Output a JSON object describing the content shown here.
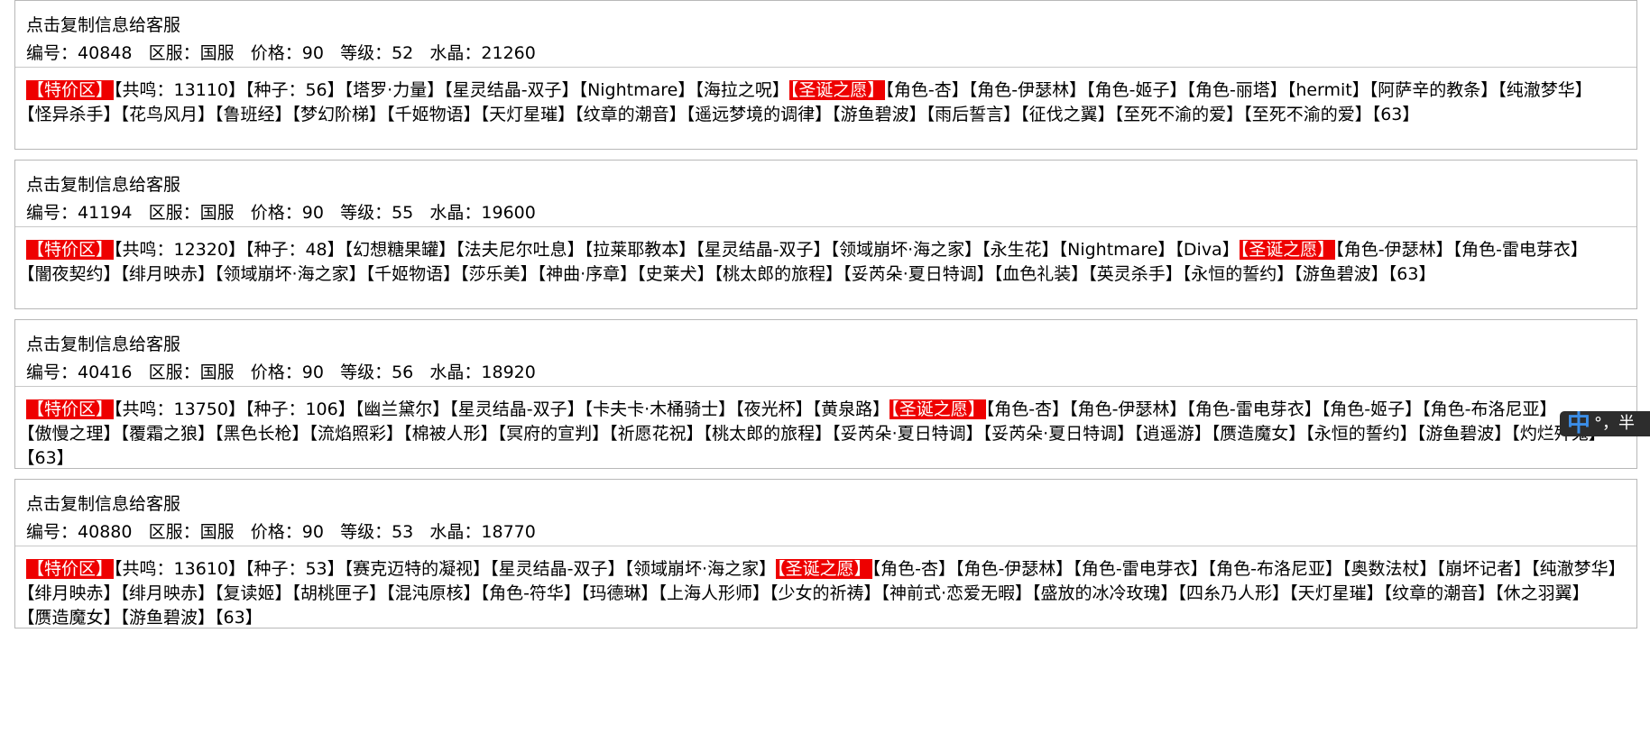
{
  "listings": [
    {
      "copy_hint": "点击复制信息给客服",
      "id_label": "编号：",
      "id": "40848",
      "server_label": "区服：",
      "server": "国服",
      "price_label": "价格：",
      "price": "90",
      "level_label": "等级：",
      "level": "52",
      "crystal_label": "水晶：",
      "crystal": "21260",
      "tags": [
        {
          "text": "【特价区】",
          "highlight": true
        },
        {
          "text": "【共鸣：13110】"
        },
        {
          "text": "【种子：56】"
        },
        {
          "text": "【塔罗·力量】"
        },
        {
          "text": "【星灵结晶-双子】"
        },
        {
          "text": "【Nightmare】"
        },
        {
          "text": "【海拉之呪】"
        },
        {
          "text": "【圣诞之愿】",
          "highlight": true
        },
        {
          "text": "【角色-杏】"
        },
        {
          "text": "【角色-伊瑟林】"
        },
        {
          "text": "【角色-姬子】"
        },
        {
          "text": "【角色-丽塔】"
        },
        {
          "text": "【hermit】"
        },
        {
          "text": "【阿萨辛的教条】"
        },
        {
          "text": "【纯澈梦华】"
        },
        {
          "text": "【怪异杀手】"
        },
        {
          "text": "【花鸟风月】"
        },
        {
          "text": "【鲁班经】"
        },
        {
          "text": "【梦幻阶梯】"
        },
        {
          "text": "【千姬物语】"
        },
        {
          "text": "【天灯星璀】"
        },
        {
          "text": "【纹章的潮音】"
        },
        {
          "text": "【遥远梦境的调律】"
        },
        {
          "text": "【游鱼碧波】"
        },
        {
          "text": "【雨后誓言】"
        },
        {
          "text": "【征伐之翼】"
        },
        {
          "text": "【至死不渝的爱】",
          "breakable": true
        },
        {
          "text": "【至死不渝的爱】"
        },
        {
          "text": "【63】"
        }
      ]
    },
    {
      "copy_hint": "点击复制信息给客服",
      "id_label": "编号：",
      "id": "41194",
      "server_label": "区服：",
      "server": "国服",
      "price_label": "价格：",
      "price": "90",
      "level_label": "等级：",
      "level": "55",
      "crystal_label": "水晶：",
      "crystal": "19600",
      "tags": [
        {
          "text": "【特价区】",
          "highlight": true
        },
        {
          "text": "【共鸣：12320】"
        },
        {
          "text": "【种子：48】"
        },
        {
          "text": "【幻想糖果罐】"
        },
        {
          "text": "【法夫尼尔吐息】"
        },
        {
          "text": "【拉莱耶教本】"
        },
        {
          "text": "【星灵结晶-双子】"
        },
        {
          "text": "【领域崩坏·海之家】"
        },
        {
          "text": "【永生花】"
        },
        {
          "text": "【Nightmare】"
        },
        {
          "text": "【Diva】"
        },
        {
          "text": "【圣诞之愿】",
          "highlight": true
        },
        {
          "text": "【角色-伊瑟林】",
          "breakable": true
        },
        {
          "text": "【角色-雷电芽衣】"
        },
        {
          "text": "【闇夜契约】"
        },
        {
          "text": "【绯月映赤】"
        },
        {
          "text": "【领域崩坏·海之家】"
        },
        {
          "text": "【千姬物语】"
        },
        {
          "text": "【莎乐美】"
        },
        {
          "text": "【神曲·序章】"
        },
        {
          "text": "【史莱犬】"
        },
        {
          "text": "【桃太郎的旅程】"
        },
        {
          "text": "【妥芮朵·夏日特调】"
        },
        {
          "text": "【血色礼装】"
        },
        {
          "text": "【英灵杀手】"
        },
        {
          "text": "【永恒的誓约】"
        },
        {
          "text": "【游鱼碧波】"
        },
        {
          "text": "【63】"
        }
      ]
    },
    {
      "copy_hint": "点击复制信息给客服",
      "id_label": "编号：",
      "id": "40416",
      "server_label": "区服：",
      "server": "国服",
      "price_label": "价格：",
      "price": "90",
      "level_label": "等级：",
      "level": "56",
      "crystal_label": "水晶：",
      "crystal": "18920",
      "tags": [
        {
          "text": "【特价区】",
          "highlight": true
        },
        {
          "text": "【共鸣：13750】"
        },
        {
          "text": "【种子：106】"
        },
        {
          "text": "【幽兰黛尔】"
        },
        {
          "text": "【星灵结晶-双子】"
        },
        {
          "text": "【卡夫卡·木桶骑士】"
        },
        {
          "text": "【夜光杯】"
        },
        {
          "text": "【黄泉路】"
        },
        {
          "text": "【圣诞之愿】",
          "highlight": true
        },
        {
          "text": "【角色-杏】"
        },
        {
          "text": "【角色-伊瑟林】"
        },
        {
          "text": "【角色-雷电芽衣】"
        },
        {
          "text": "【角色-姬子】",
          "breakable": true
        },
        {
          "text": "【角色-布洛尼亚】"
        },
        {
          "text": "【傲慢之理】"
        },
        {
          "text": "【覆霜之狼】"
        },
        {
          "text": "【黑色长枪】"
        },
        {
          "text": "【流焰照彩】"
        },
        {
          "text": "【棉被人形】"
        },
        {
          "text": "【冥府的宣判】"
        },
        {
          "text": "【祈愿花祝】"
        },
        {
          "text": "【桃太郎的旅程】"
        },
        {
          "text": "【妥芮朵·夏日特调】"
        },
        {
          "text": "【妥芮朵·夏日特调】"
        },
        {
          "text": "【逍遥游】"
        },
        {
          "text": "【赝造魔女】"
        },
        {
          "text": "【永恒的誓约】"
        },
        {
          "text": "【游鱼碧波】"
        },
        {
          "text": "【灼烂歼鬼】"
        },
        {
          "text": "【63】"
        }
      ]
    },
    {
      "copy_hint": "点击复制信息给客服",
      "id_label": "编号：",
      "id": "40880",
      "server_label": "区服：",
      "server": "国服",
      "price_label": "价格：",
      "price": "90",
      "level_label": "等级：",
      "level": "53",
      "crystal_label": "水晶：",
      "crystal": "18770",
      "tags": [
        {
          "text": "【特价区】",
          "highlight": true
        },
        {
          "text": "【共鸣：13610】"
        },
        {
          "text": "【种子：53】"
        },
        {
          "text": "【赛克迈特的凝视】"
        },
        {
          "text": "【星灵结晶-双子】"
        },
        {
          "text": "【领域崩坏·海之家】"
        },
        {
          "text": "【圣诞之愿】",
          "highlight": true
        },
        {
          "text": "【角色-杏】"
        },
        {
          "text": "【角色-伊瑟林】"
        },
        {
          "text": "【角色-雷电芽衣】"
        },
        {
          "text": "【角色-布洛尼亚】"
        },
        {
          "text": "【奥数法杖】",
          "breakable": true
        },
        {
          "text": "【崩坏记者】"
        },
        {
          "text": "【纯澈梦华】"
        },
        {
          "text": "【绯月映赤】"
        },
        {
          "text": "【绯月映赤】"
        },
        {
          "text": "【复读姬】"
        },
        {
          "text": "【胡桃匣子】"
        },
        {
          "text": "【混沌原核】"
        },
        {
          "text": "【角色-符华】"
        },
        {
          "text": "【玛德琳】"
        },
        {
          "text": "【上海人形师】"
        },
        {
          "text": "【少女的祈祷】"
        },
        {
          "text": "【神前式·恋爱无暇】"
        },
        {
          "text": "【盛放的冰冷玫瑰】",
          "breakable": true
        },
        {
          "text": "【四糸乃人形】"
        },
        {
          "text": "【天灯星璀】"
        },
        {
          "text": "【纹章的潮音】"
        },
        {
          "text": "【休之羽翼】"
        },
        {
          "text": "【赝造魔女】"
        },
        {
          "text": "【游鱼碧波】"
        },
        {
          "text": "【63】"
        }
      ]
    }
  ],
  "ime_indicator": {
    "glyph": "中",
    "text": "°，半"
  }
}
